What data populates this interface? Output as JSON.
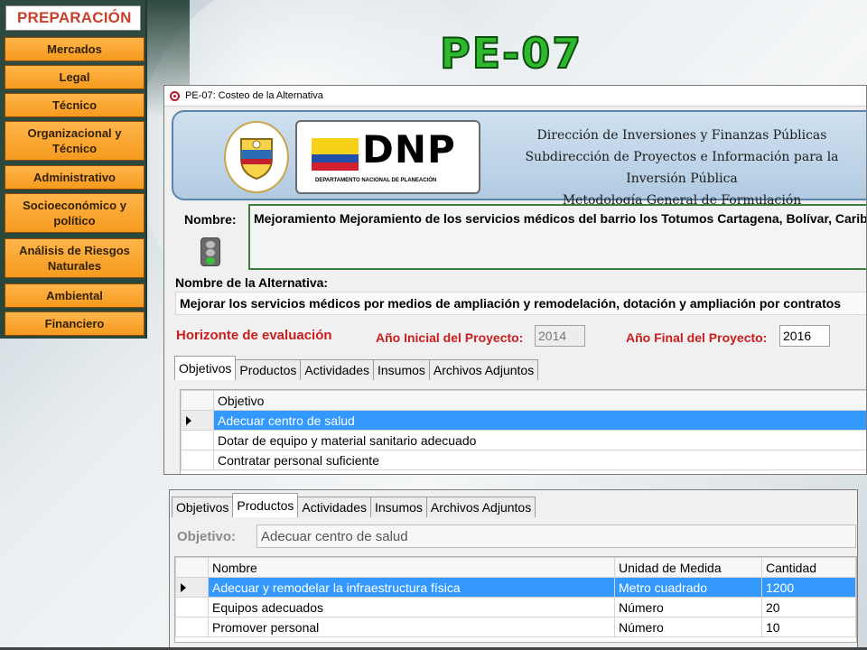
{
  "sidebar": {
    "title": "PREPARACIÓN",
    "items": [
      {
        "label": "Mercados",
        "name": "sidebar-item-mercados"
      },
      {
        "label": "Legal",
        "name": "sidebar-item-legal"
      },
      {
        "label": "Técnico",
        "name": "sidebar-item-tecnico"
      },
      {
        "label": "Organizacional y Técnico",
        "name": "sidebar-item-organizacional"
      },
      {
        "label": "Administrativo",
        "name": "sidebar-item-administrativo"
      },
      {
        "label": "Socioeconómico y político",
        "name": "sidebar-item-socioeconomico"
      },
      {
        "label": "Análisis de Riesgos Naturales",
        "name": "sidebar-item-riesgos"
      },
      {
        "label": "Ambiental",
        "name": "sidebar-item-ambiental"
      },
      {
        "label": "Financiero",
        "name": "sidebar-item-financiero"
      }
    ]
  },
  "page_title": "PE-07",
  "window": {
    "title": "PE-07: Costeo de la Alternativa",
    "header": {
      "logo_text": "DNP",
      "logo_subtext": "DEPARTAMENTO NACIONAL DE PLANEACIÓN",
      "line1": "Dirección de Inversiones y Finanzas Públicas",
      "line2": "Subdirección de Proyectos e Información para la Inversión Pública",
      "line3": "Metodología General de Formulación"
    },
    "nombre_label": "Nombre:",
    "nombre_value": "Mejoramiento Mejoramiento de los servicios médicos del barrio los Totumos Cartagena, Bolívar, Caribe",
    "alternativa_label": "Nombre de la Alternativa:",
    "alternativa_value": "Mejorar los servicios médicos por medios de ampliación y remodelación, dotación y ampliación por contratos",
    "horizonte_label": "Horizonte de evaluación",
    "anio_inicial_label": "Año Inicial del Proyecto:",
    "anio_inicial_value": "2014",
    "anio_final_label": "Año Final del Proyecto:",
    "anio_final_value": "2016",
    "tabs": [
      "Objetivos",
      "Productos",
      "Actividades",
      "Insumos",
      "Archivos Adjuntos"
    ],
    "active_tab": "Objetivos",
    "objetivos_grid": {
      "header": "Objetivo",
      "rows": [
        "Adecuar centro de salud",
        "Dotar de equipo y material sanitario adecuado",
        "Contratar personal suficiente"
      ]
    }
  },
  "window2": {
    "tabs": [
      "Objetivos",
      "Productos",
      "Actividades",
      "Insumos",
      "Archivos Adjuntos"
    ],
    "active_tab": "Productos",
    "objetivo_label": "Objetivo:",
    "objetivo_value": "Adecuar centro de salud",
    "productos_grid": {
      "headers": [
        "Nombre",
        "Unidad de Medida",
        "Cantidad"
      ],
      "rows": [
        [
          "Adecuar y remodelar la infraestructura física",
          "Metro cuadrado",
          "1200"
        ],
        [
          "Equipos adecuados",
          "Número",
          "20"
        ],
        [
          "Promover personal",
          "Número",
          "10"
        ]
      ]
    }
  },
  "colors": {
    "sidebar_button": "#f59a1e",
    "title_green": "#2db82d",
    "selection_blue": "#3399ff",
    "label_red": "#c81e1e"
  }
}
